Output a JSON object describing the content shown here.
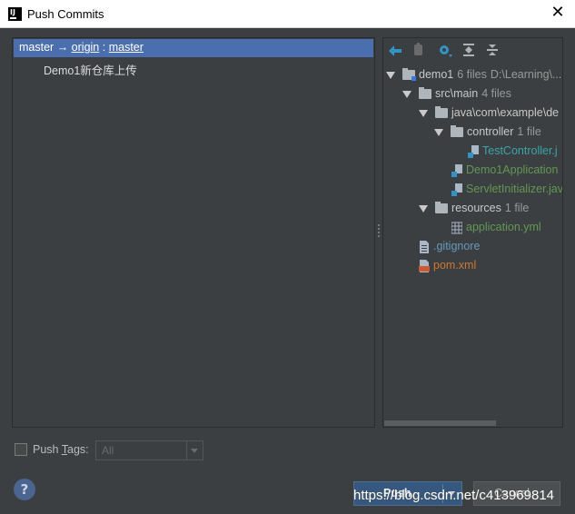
{
  "window": {
    "title": "Push Commits",
    "app_icon": "IJ",
    "close_icon": "close-icon"
  },
  "commits_panel": {
    "branch": {
      "local": "master",
      "arrow": "→",
      "remote": "origin",
      "separator": ":",
      "remote_branch": "master"
    },
    "commits": [
      {
        "message": "Demo1新仓库上传"
      }
    ]
  },
  "toolbar": {
    "icons": [
      "expand-collapse-icon",
      "edit-source-icon",
      "settings-icon",
      "expand-all-icon",
      "collapse-all-icon"
    ]
  },
  "tree": {
    "root": {
      "name": "demo1",
      "count": "6 files",
      "path": "D:\\Learning\\..."
    },
    "src_main": {
      "name": "src\\main",
      "count": "4 files"
    },
    "java_pkg": {
      "name": "java\\com\\example\\de"
    },
    "controller": {
      "name": "controller",
      "count": "1 file"
    },
    "test_controller": {
      "name": "TestController.j"
    },
    "demo1_app": {
      "name": "Demo1Application"
    },
    "servlet_init": {
      "name": "ServletInitializer.jav"
    },
    "resources": {
      "name": "resources",
      "count": "1 file"
    },
    "application_yml": {
      "name": "application.yml"
    },
    "gitignore": {
      "name": ".gitignore"
    },
    "pom": {
      "name": "pom.xml"
    }
  },
  "footer": {
    "push_tags_label_pre": "Push ",
    "push_tags_label_u": "T",
    "push_tags_label_post": "ags:",
    "tags_value": "All",
    "push_label": "Push",
    "cancel_label": "Cancel",
    "help_label": "?"
  },
  "watermark": "https://blog.csdn.net/c413969814",
  "colors": {
    "selection": "#4b6eaf",
    "background": "#3c3f41",
    "modified_file": "#629755",
    "new_file": "#3aa6a8",
    "default_button": "#365880"
  }
}
